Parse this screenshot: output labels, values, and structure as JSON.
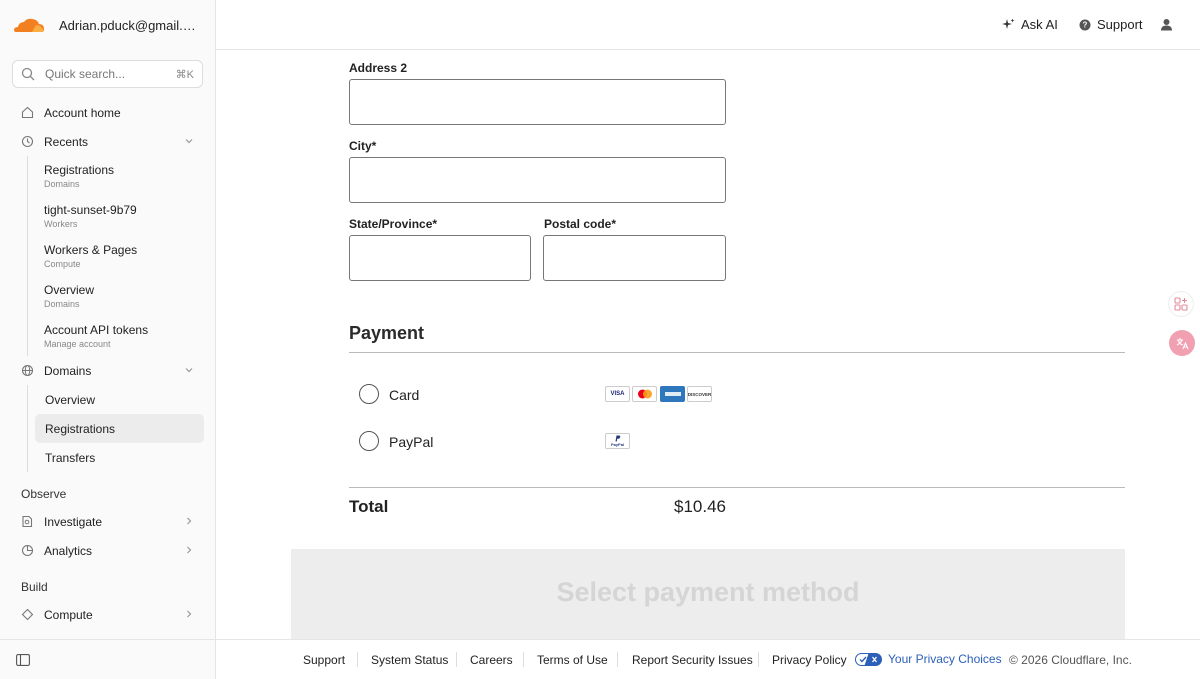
{
  "sidebar": {
    "account_email": "Adrian.pduck@gmail.co...",
    "search": {
      "placeholder": "Quick search...",
      "shortcut": "⌘K"
    },
    "account_home": "Account home",
    "recents": {
      "label": "Recents",
      "items": [
        {
          "title": "Registrations",
          "subtitle": "Domains"
        },
        {
          "title": "tight-sunset-9b79",
          "subtitle": "Workers"
        },
        {
          "title": "Workers & Pages",
          "subtitle": "Compute"
        },
        {
          "title": "Overview",
          "subtitle": "Domains"
        },
        {
          "title": "Account API tokens",
          "subtitle": "Manage account"
        }
      ]
    },
    "domains": {
      "label": "Domains",
      "items": [
        "Overview",
        "Registrations",
        "Transfers"
      ],
      "active": "Registrations"
    },
    "observe_label": "Observe",
    "investigate": "Investigate",
    "analytics": "Analytics",
    "build_label": "Build",
    "compute": "Compute"
  },
  "header": {
    "ask_ai": "Ask AI",
    "support": "Support"
  },
  "form": {
    "address2_label": "Address 2",
    "city_label": "City*",
    "state_label": "State/Province*",
    "postal_label": "Postal code*",
    "address2_value": "",
    "city_value": "",
    "state_value": "",
    "postal_value": ""
  },
  "payment": {
    "title": "Payment",
    "options": [
      {
        "label": "Card",
        "selected": false
      },
      {
        "label": "PayPal",
        "selected": false
      }
    ],
    "card_brands": [
      "VISA",
      "",
      "",
      "DISCOVER"
    ],
    "paypal_mark": "PayPal",
    "total_label": "Total",
    "total_value": "$10.46",
    "submit_label": "Select payment method"
  },
  "footer": {
    "links": [
      "Support",
      "System Status",
      "Careers",
      "Terms of Use",
      "Report Security Issues",
      "Privacy Policy"
    ],
    "privacy_choices": "Your Privacy Choices",
    "copyright": "© 2026 Cloudflare, Inc."
  },
  "colors": {
    "brand_orange": "#f38020",
    "link_blue": "#2c5fb8",
    "accent_pink": "#f0a0b0"
  }
}
